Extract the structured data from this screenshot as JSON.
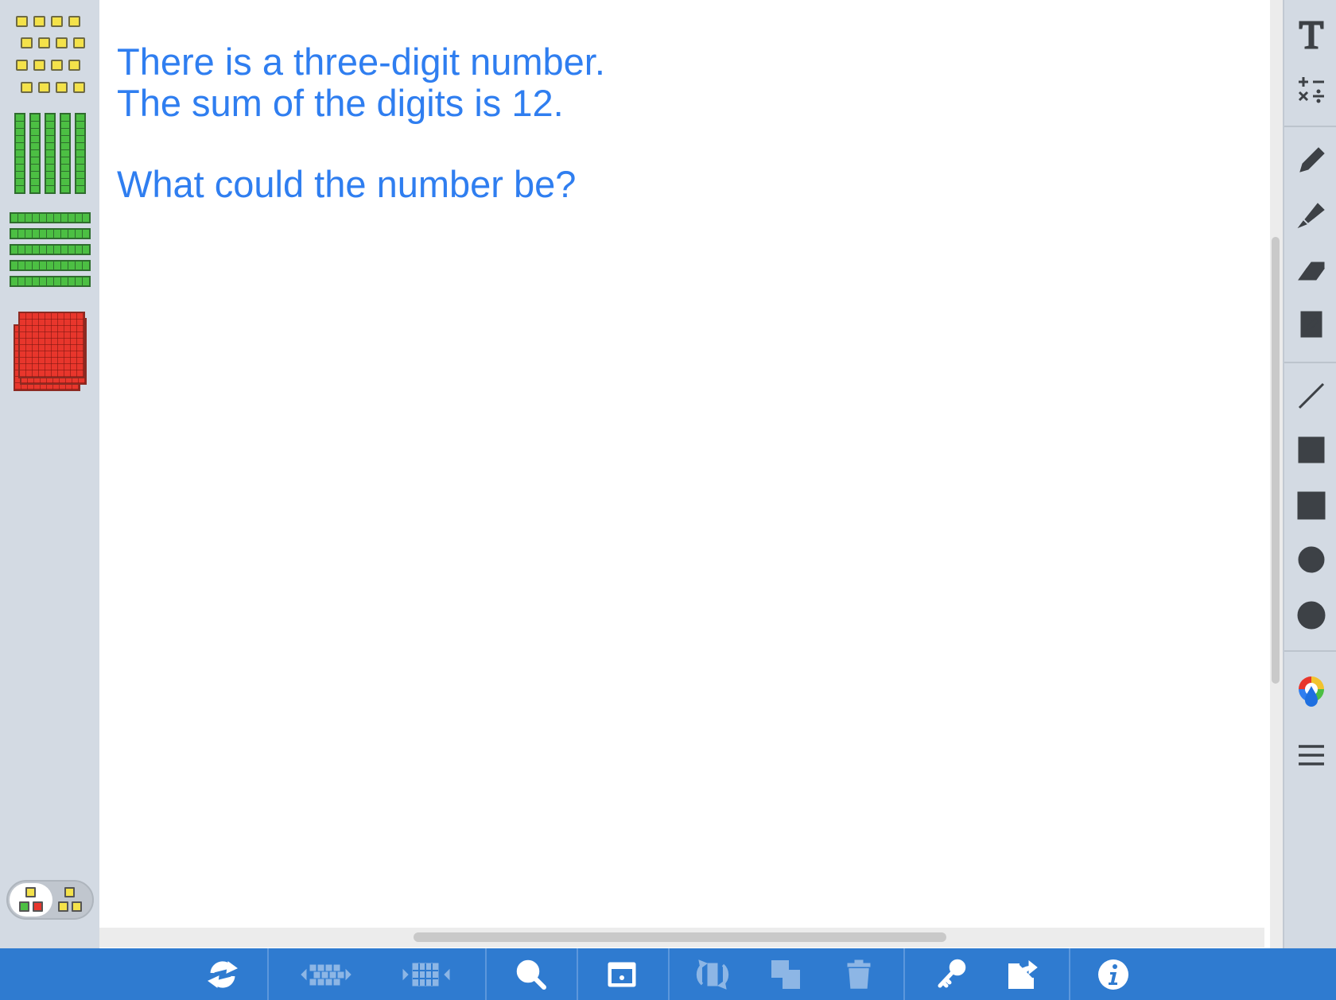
{
  "canvas": {
    "prompt": {
      "line1": "There is a three-digit number.",
      "line2": "The sum of the digits is 12.",
      "line3": "What could the number be?"
    }
  },
  "left_palette": {
    "items": [
      "ones-cubes",
      "tens-rods-vertical",
      "tens-rods-horizontal",
      "hundreds-flats"
    ],
    "mode_toggle": {
      "selected": "mixed-colors"
    },
    "colors": {
      "ones": "#f4e24a",
      "tens": "#4cbf43",
      "hundreds": "#e8362c"
    }
  },
  "right_toolbar": {
    "tools": [
      "text-icon",
      "math-symbols-icon",
      "pen-icon",
      "highlighter-icon",
      "eraser-icon",
      "note-icon",
      "line-icon",
      "rectangle-outline-icon",
      "rectangle-filled-icon",
      "circle-outline-icon",
      "circle-filled-icon",
      "color-picker-icon",
      "menu-icon"
    ]
  },
  "bottom_bar": {
    "buttons": [
      "reset-icon",
      "split-icon",
      "group-icon",
      "zoom-out-icon",
      "screen-icon",
      "rotate-icon",
      "duplicate-icon",
      "trash-icon",
      "key-icon",
      "share-icon",
      "info-icon"
    ],
    "accent": "#2f7bd0"
  },
  "prompt_color": "#2f7ef0"
}
